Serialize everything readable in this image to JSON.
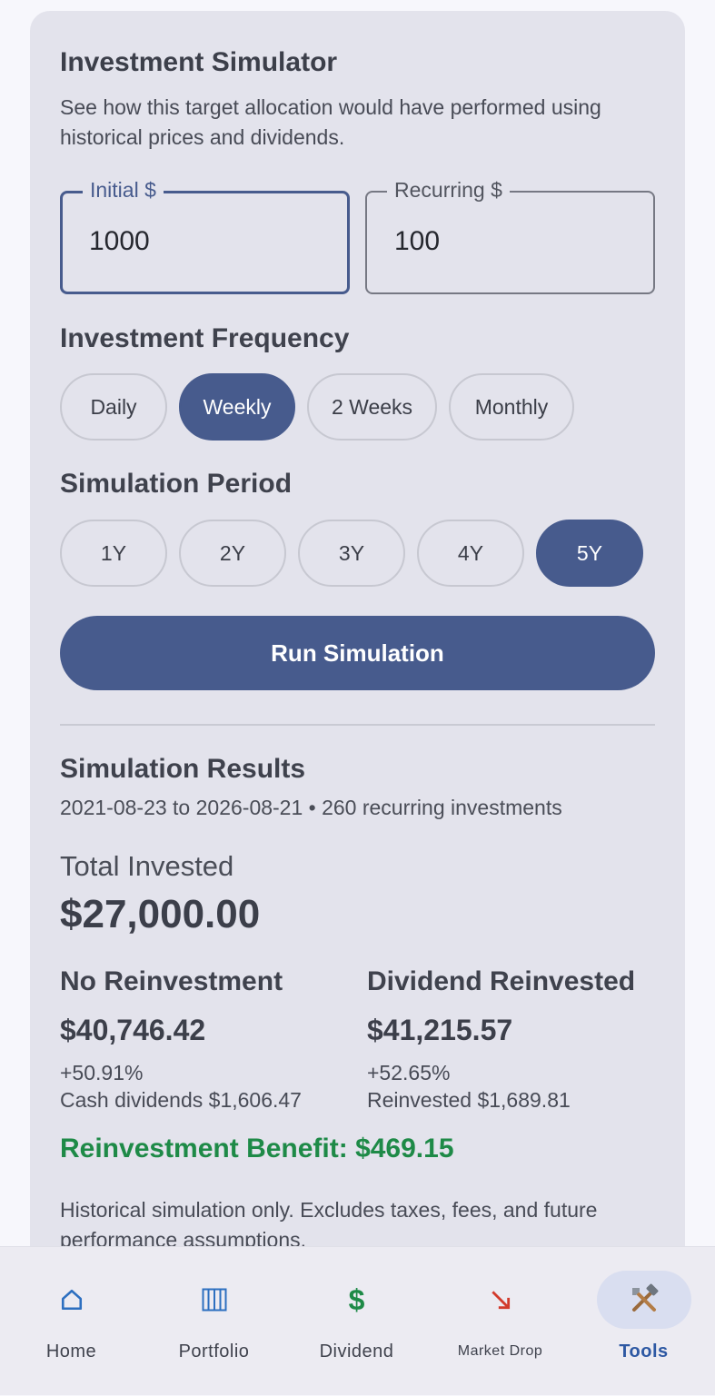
{
  "simulator": {
    "title": "Investment Simulator",
    "subtitle": "See how this target allocation would have performed using historical prices and dividends."
  },
  "inputs": {
    "initial_label": "Initial $",
    "initial_value": "1000",
    "recurring_label": "Recurring $",
    "recurring_value": "100"
  },
  "frequency": {
    "heading": "Investment Frequency",
    "options": [
      "Daily",
      "Weekly",
      "2 Weeks",
      "Monthly"
    ],
    "selected": "Weekly"
  },
  "period": {
    "heading": "Simulation Period",
    "options": [
      "1Y",
      "2Y",
      "3Y",
      "4Y",
      "5Y"
    ],
    "selected": "5Y"
  },
  "run_button": "Run Simulation",
  "results": {
    "title": "Simulation Results",
    "range": "2021-08-23 to 2026-08-21 • 260 recurring investments",
    "total_label": "Total Invested",
    "total_value": "$27,000.00",
    "no_reinvest": {
      "heading": "No Reinvestment",
      "value": "$40,746.42",
      "pct": "+50.91%",
      "detail": "Cash dividends $1,606.47"
    },
    "reinvested": {
      "heading": "Dividend Reinvested",
      "value": "$41,215.57",
      "pct": "+52.65%",
      "detail": "Reinvested $1,689.81"
    },
    "benefit": "Reinvestment Benefit: $469.15",
    "disclaimer": "Historical simulation only. Excludes taxes, fees, and future performance assumptions."
  },
  "nav": {
    "items": [
      {
        "label": "Home",
        "icon": "home-icon"
      },
      {
        "label": "Portfolio",
        "icon": "portfolio-icon"
      },
      {
        "label": "Dividend",
        "icon": "dollar-icon"
      },
      {
        "label": "Market Drop",
        "icon": "trend-down-icon"
      },
      {
        "label": "Tools",
        "icon": "tools-icon"
      }
    ],
    "active": "Tools"
  },
  "colors": {
    "accent": "#475b8d",
    "benefit": "#1e8a47",
    "card": "#e3e3ec",
    "nav_active": "#2d58a3"
  }
}
